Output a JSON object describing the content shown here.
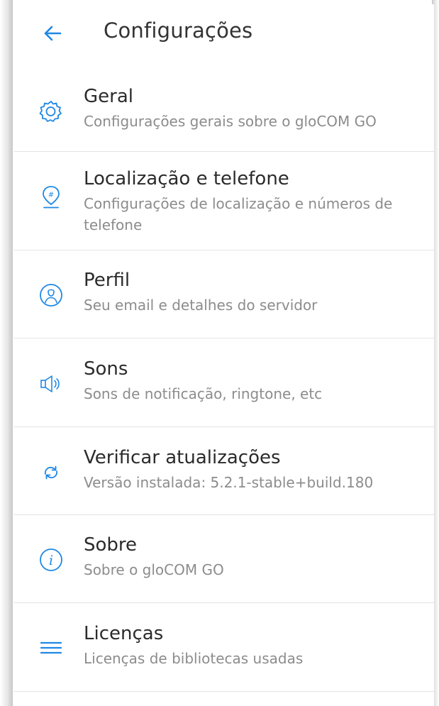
{
  "appbar": {
    "title": "Configurações",
    "back_icon": "arrow-left-icon"
  },
  "accent_color": "#1e88e5",
  "settings": [
    {
      "id": "general",
      "icon": "gear-icon",
      "label": "Geral",
      "description": "Configurações gerais sobre o gloCOM GO"
    },
    {
      "id": "location-phone",
      "icon": "location-pin-icon",
      "label": "Localização e telefone",
      "description": "Configurações de localização e números de telefone"
    },
    {
      "id": "profile",
      "icon": "user-icon",
      "label": "Perfil",
      "description": "Seu email e detalhes do servidor"
    },
    {
      "id": "sounds",
      "icon": "speaker-icon",
      "label": "Sons",
      "description": "Sons de notificação, ringtone, etc"
    },
    {
      "id": "check-updates",
      "icon": "refresh-icon",
      "label": "Verificar atualizações",
      "description": "Versão instalada: 5.2.1-stable+build.180"
    },
    {
      "id": "about",
      "icon": "info-icon",
      "label": "Sobre",
      "description": "Sobre o gloCOM GO"
    },
    {
      "id": "licenses",
      "icon": "menu-lines-icon",
      "label": "Licenças",
      "description": "Licenças de bibliotecas usadas"
    }
  ]
}
